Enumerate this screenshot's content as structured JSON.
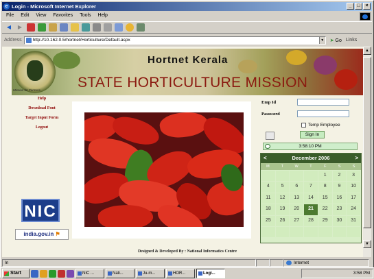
{
  "window": {
    "title": "Login - Microsoft Internet Explorer",
    "controls": [
      "_",
      "□",
      "×"
    ]
  },
  "menu": [
    "File",
    "Edit",
    "View",
    "Favorites",
    "Tools",
    "Help"
  ],
  "address": {
    "label": "Address",
    "url": "http://10.162.0.5/hortnet/Horticulture/Default.aspx",
    "go": "Go",
    "links": "Links"
  },
  "banner": {
    "title1": "Hortnet  Kerala",
    "title2": "STATE HORTICULTURE MISSION",
    "emblem_caption": "Mission for Farmers"
  },
  "nav": [
    "Help",
    "Download Font",
    "Target Input Form",
    "Logout"
  ],
  "logos": {
    "nic": "NIC",
    "indiagov": "india.gov.in"
  },
  "login": {
    "emp_label": "Emp Id",
    "password_label": "Password",
    "temp_employee": "Temp Employee",
    "signin": "Sign In"
  },
  "clock": {
    "time": "3:58:10 PM"
  },
  "calendar": {
    "month": "December 2006",
    "prev": "<",
    "next": ">",
    "dow": [
      "M",
      "T",
      "W",
      "T",
      "F",
      "S",
      "S"
    ],
    "weeks": [
      [
        "",
        "",
        "",
        "",
        "1",
        "2",
        "3"
      ],
      [
        "4",
        "5",
        "6",
        "7",
        "8",
        "9",
        "10"
      ],
      [
        "11",
        "12",
        "13",
        "14",
        "15",
        "16",
        "17"
      ],
      [
        "18",
        "19",
        "20",
        "21",
        "22",
        "23",
        "24"
      ],
      [
        "25",
        "26",
        "27",
        "28",
        "29",
        "30",
        "31"
      ],
      [
        "",
        "",
        "",
        "",
        "",
        "",
        ""
      ]
    ],
    "today": "21"
  },
  "footer": "Designed & Developed By : National Informatics Centre",
  "status": {
    "text": "In",
    "zone": "Internet"
  },
  "taskbar": {
    "start": "Start",
    "tasks": [
      "NIC ...",
      "Nati...",
      "Ju-m...",
      "HOR...",
      "Logi..."
    ],
    "clock": "3:58 PM"
  }
}
